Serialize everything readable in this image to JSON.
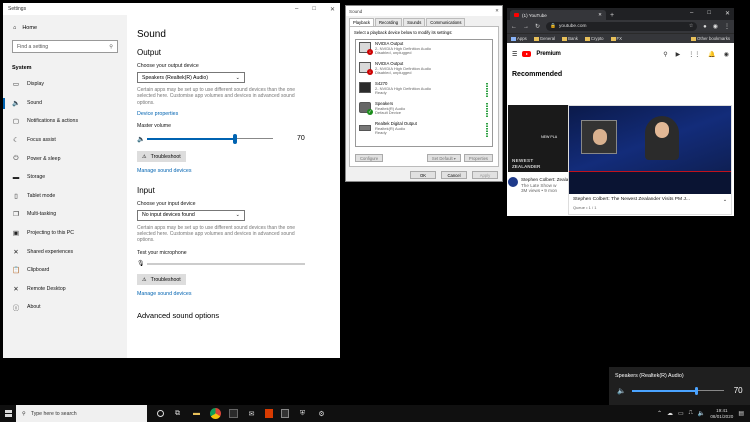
{
  "settings": {
    "window_title": "Settings",
    "home": "Home",
    "search_placeholder": "Find a setting",
    "section": "System",
    "nav": [
      {
        "label": "Display",
        "icon": "display-icon",
        "glyph": "▭"
      },
      {
        "label": "Sound",
        "icon": "sound-icon",
        "glyph": "🔈"
      },
      {
        "label": "Notifications & actions",
        "icon": "notifications-icon",
        "glyph": "▢"
      },
      {
        "label": "Focus assist",
        "icon": "focus-assist-icon",
        "glyph": "☾"
      },
      {
        "label": "Power & sleep",
        "icon": "power-icon",
        "glyph": "⏻"
      },
      {
        "label": "Storage",
        "icon": "storage-icon",
        "glyph": "▬"
      },
      {
        "label": "Tablet mode",
        "icon": "tablet-mode-icon",
        "glyph": "▯"
      },
      {
        "label": "Multi-tasking",
        "icon": "multitasking-icon",
        "glyph": "❐"
      },
      {
        "label": "Projecting to this PC",
        "icon": "projecting-icon",
        "glyph": "▣"
      },
      {
        "label": "Shared experiences",
        "icon": "shared-experiences-icon",
        "glyph": "✕"
      },
      {
        "label": "Clipboard",
        "icon": "clipboard-icon",
        "glyph": "📋"
      },
      {
        "label": "Remote Desktop",
        "icon": "remote-desktop-icon",
        "glyph": "✕"
      },
      {
        "label": "About",
        "icon": "info-icon",
        "glyph": "ⓘ"
      }
    ],
    "active_nav": "Sound",
    "page_title": "Sound",
    "output": {
      "heading": "Output",
      "choose_label": "Choose your output device",
      "device": "Speakers (Realtek(R) Audio)",
      "description": "Certain apps may be set up to use different sound devices than the one selected here. Customise app volumes and devices in advanced sound options.",
      "properties_link": "Device properties",
      "master_label": "Master volume",
      "master_volume": 70,
      "troubleshoot": "Troubleshoot",
      "manage_link": "Manage sound devices"
    },
    "input": {
      "heading": "Input",
      "choose_label": "Choose your input device",
      "device": "No input devices found",
      "description": "Certain apps may be set up to use different sound devices than the one selected here. Customise app volumes and devices in advanced sound options.",
      "test_label": "Test your microphone",
      "troubleshoot": "Troubleshoot",
      "manage_link": "Manage sound devices"
    },
    "advanced_heading": "Advanced sound options"
  },
  "sound_dialog": {
    "title": "Sound",
    "tabs": [
      "Playback",
      "Recording",
      "Sounds",
      "Communications"
    ],
    "instruction": "Select a playback device below to modify its settings:",
    "devices": [
      {
        "name": "NVIDIA Output",
        "line2": "2- NVIDIA High Definition Audio",
        "status": "Disabled, unplugged",
        "icon": "audio-device-icon",
        "badge": "disabled"
      },
      {
        "name": "NVIDIA Output",
        "line2": "2- NVIDIA High Definition Audio",
        "status": "Disabled, unplugged",
        "icon": "audio-device-icon",
        "badge": "disabled"
      },
      {
        "name": "S4270",
        "line2": "2- NVIDIA High Definition Audio",
        "status": "Ready",
        "icon": "monitor-icon",
        "badge": ""
      },
      {
        "name": "Speakers",
        "line2": "Realtek(R) Audio",
        "status": "Default Device",
        "icon": "speaker-icon",
        "badge": "default"
      },
      {
        "name": "Realtek Digital Output",
        "line2": "Realtek(R) Audio",
        "status": "Ready",
        "icon": "digital-output-icon",
        "badge": ""
      }
    ],
    "buttons": {
      "configure": "Configure",
      "set_default": "Set Default",
      "properties": "Properties",
      "ok": "OK",
      "cancel": "Cancel",
      "apply": "Apply"
    }
  },
  "chrome": {
    "tab_title": "(1) YouTube",
    "url": "youtube.com",
    "bookmarks": [
      "Apps",
      "General",
      "Bank",
      "Crypto",
      "FX"
    ],
    "other_bookmarks": "Other bookmarks",
    "youtube": {
      "brand": "Premium",
      "recommended": "Recommended",
      "thumb_text_1": "NEWEST",
      "thumb_text_2": "ZEALANDER",
      "thumb_overlay": "NEW PLA",
      "video_title": "Stephen Colbert: The Newest Zealander Visits PM J...",
      "card_title": "Stephen Colbert: Zealander Visits PM",
      "card_channel": "The Late Show w",
      "card_views": "3M views • 9 mon",
      "queue": "Queue • 1 / 1",
      "accent": "#ff0000"
    }
  },
  "volume_flyout": {
    "device": "Speakers (Realtek(R) Audio)",
    "volume": 70
  },
  "taskbar": {
    "search_placeholder": "Type here to search",
    "time": "19:41",
    "date": "08/01/2020"
  }
}
